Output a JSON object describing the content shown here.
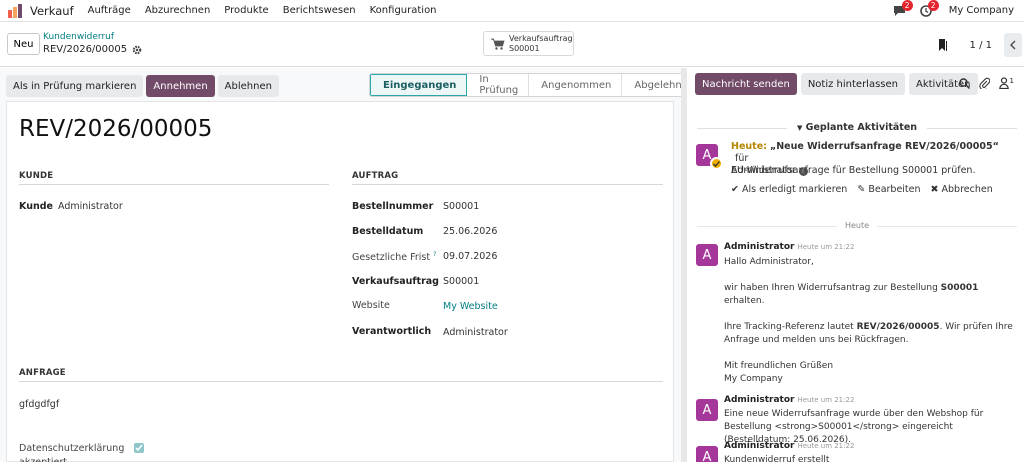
{
  "navbar": {
    "app_name": "Verkauf",
    "menu": [
      "Aufträge",
      "Abzurechnen",
      "Produkte",
      "Berichtswesen",
      "Konfiguration"
    ],
    "messages_badge": "2",
    "activities_badge": "2",
    "company": "My Company",
    "logo_colors": [
      "#f06050",
      "#f4a460",
      "#714b67"
    ]
  },
  "control": {
    "new_label": "Neu",
    "breadcrumb": "Kundenwiderruf",
    "record_name": "REV/2026/00005",
    "smart_button": {
      "title": "Verkaufsauftrag",
      "value": "S00001"
    },
    "pager": "1 / 1"
  },
  "statusbar": {
    "buttons": [
      "Als in Prüfung markieren",
      "Annehmen",
      "Ablehnen"
    ],
    "stages": [
      "Eingegangen",
      "In Prüfung",
      "Angenommen",
      "Abgelehnt"
    ],
    "active_stage": "Eingegangen"
  },
  "form": {
    "title": "REV/2026/00005",
    "sections": {
      "customer": "KUNDE",
      "order": "AUFTRAG",
      "request": "ANFRAGE"
    },
    "customer_label": "Kunde",
    "customer_value": "Administrator",
    "order_fields": [
      {
        "label": "Bestellnummer",
        "value": "S00001"
      },
      {
        "label": "Bestelldatum",
        "value": "25.06.2026"
      },
      {
        "label": "Gesetzliche Frist",
        "value": "09.07.2026",
        "help": "?"
      },
      {
        "label": "Verkaufsauftrag",
        "value": "S00001"
      },
      {
        "label": "Website",
        "value": "My Website"
      },
      {
        "label": "Verantwortlich",
        "value": "Administrator"
      }
    ],
    "request_text": "gfdgdfgf",
    "privacy_label": "Datenschutzerklärung akzeptiert"
  },
  "chatter": {
    "buttons": [
      "Nachricht senden",
      "Notiz hinterlassen",
      "Aktivitäten"
    ],
    "follower_count": "1",
    "planned_heading": "Geplante Aktivitäten",
    "activity": {
      "avatar": "A",
      "when": "Heute:",
      "summary": "„Neue Widerrufsanfrage REV/2026/00005“",
      "for_text": "für",
      "assignee": "Administrator",
      "note": "EU-Widerrufsanfrage für Bestellung S00001 prüfen.",
      "done_label": "Als erledigt markieren",
      "edit_label": "Bearbeiten",
      "cancel_label": "Abbrechen"
    },
    "day_separator": "Heute",
    "messages": [
      {
        "avatar": "A",
        "author": "Administrator",
        "time": "Heute um 21:22",
        "greeting": "Hallo Administrator,",
        "p1_a": "wir haben Ihren Widerrufsantrag zur Bestellung ",
        "p1_b": "S00001",
        "p1_c": "erhalten.",
        "p2_a": "Ihre Tracking-Referenz lautet ",
        "p2_b": "REV/2026/00005",
        "p2_c": ". Wir prüfen Ihre Anfrage und melden uns bei Rückfragen.",
        "closing": "Mit freundlichen Grüßen",
        "signature": "My Company"
      },
      {
        "avatar": "A",
        "author": "Administrator",
        "time": "Heute um 21:22",
        "body": "Eine neue Widerrufsanfrage wurde über den Webshop für Bestellung <strong>S00001</strong> eingereicht (Bestelldatum: 25.06.2026)."
      },
      {
        "avatar": "A",
        "author": "Administrator",
        "time": "Heute um 21:22",
        "body": "Kundenwiderruf erstellt"
      }
    ]
  },
  "colors": {
    "primary": "#714b67",
    "link": "#017e84",
    "avatar": "#a5379a",
    "badge": "#e4252f"
  }
}
